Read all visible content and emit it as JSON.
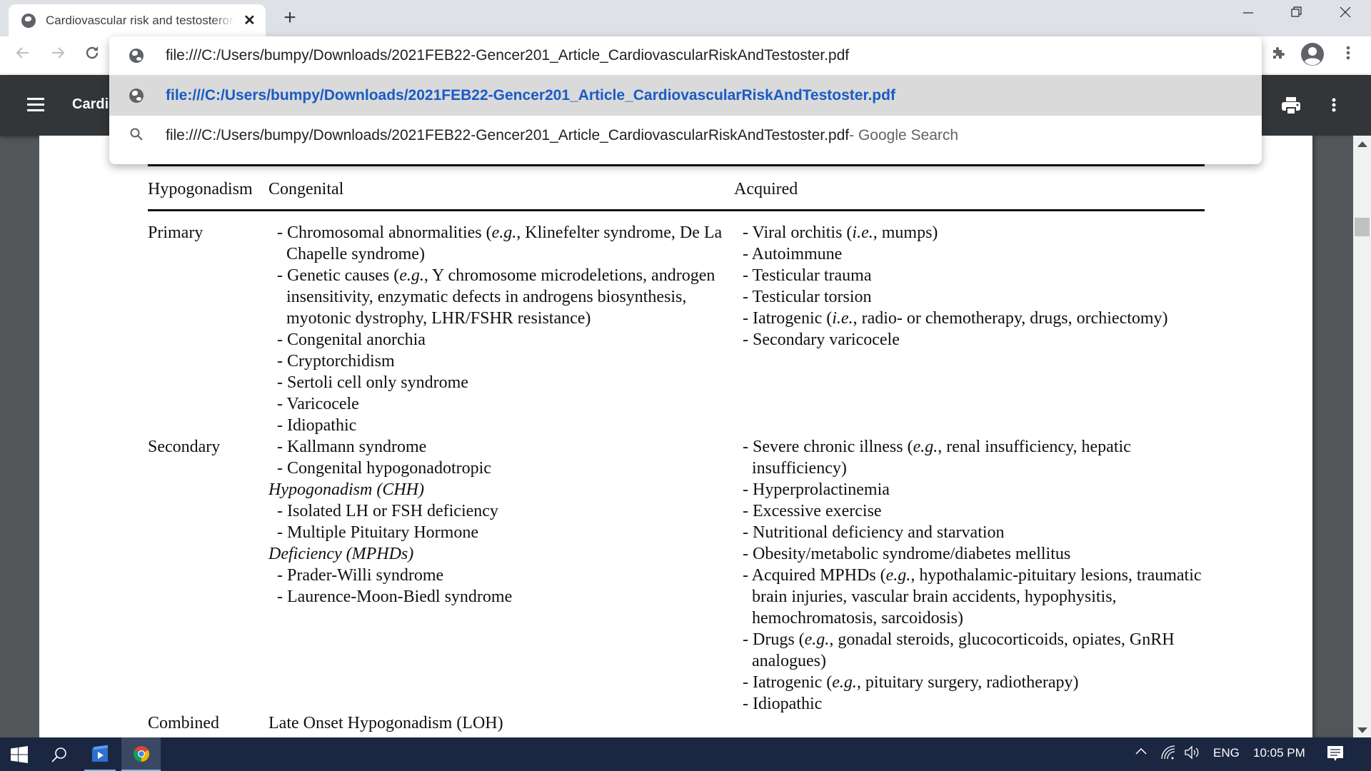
{
  "browser": {
    "tab_title": "Cardiovascular risk and testosterone",
    "new_tab_label": "+",
    "address_text": "file:///C:/Users/bumpy/Downloads/2021FEB22-Gencer201_Article_CardiovascularRiskAndTestoster.pdf",
    "suggestions": [
      {
        "icon": "globe-icon",
        "text": "file:///C:/Users/bumpy/Downloads/2021FEB22-Gencer201_Article_CardiovascularRiskAndTestoster.pdf",
        "suffix": "",
        "selected": true
      },
      {
        "icon": "search-icon",
        "text": "file:///C:/Users/bumpy/Downloads/2021FEB22-Gencer201_Article_CardiovascularRiskAndTestoster.pdf",
        "suffix": " - Google Search",
        "selected": false
      }
    ],
    "accent_color": "#1a5bc4"
  },
  "pdf_viewer": {
    "title": "Cardiovascular risk and testosterone"
  },
  "table": {
    "headers": [
      "Hypogonadism",
      "Congenital",
      "Acquired"
    ],
    "rows": [
      {
        "label": "Primary",
        "congenital": [
          {
            "pre": "- Chromosomal abnormalities (",
            "it": "e.g.",
            "post": ", Klinefelter syndrome, De La Chapelle syndrome)"
          },
          {
            "pre": "- Genetic causes (",
            "it": "e.g.",
            "post": ", Y chromosome microdeletions, androgen insensitivity, enzymatic defects in androgens biosynthesis, myotonic dystrophy, LHR/FSHR resistance)"
          },
          {
            "pre": "- Congenital anorchia"
          },
          {
            "pre": "- Cryptorchidism"
          },
          {
            "pre": "- Sertoli cell only syndrome"
          },
          {
            "pre": "- Varicocele"
          },
          {
            "pre": "- Idiopathic"
          }
        ],
        "acquired": [
          {
            "pre": "- Viral orchitis (",
            "it": "i.e.",
            "post": ", mumps)"
          },
          {
            "pre": "- Autoimmune"
          },
          {
            "pre": "- Testicular trauma"
          },
          {
            "pre": "- Testicular torsion"
          },
          {
            "pre": "- Iatrogenic (",
            "it": "i.e.",
            "post": ", radio- or chemotherapy, drugs, orchiectomy)"
          },
          {
            "pre": "- Secondary varicocele"
          }
        ]
      },
      {
        "label": "Secondary",
        "congenital": [
          {
            "pre": "- Kallmann syndrome"
          },
          {
            "pre": "- Congenital hypogonadotropic"
          },
          {
            "it_line": "Hypogonadism (CHH)"
          },
          {
            "pre": "- Isolated LH or FSH deficiency"
          },
          {
            "pre": "- Multiple Pituitary Hormone"
          },
          {
            "it_line": "Deficiency (MPHDs)"
          },
          {
            "pre": "- Prader-Willi syndrome"
          },
          {
            "pre": "- Laurence-Moon-Biedl syndrome"
          }
        ],
        "acquired": [
          {
            "pre": "- Severe chronic illness (",
            "it": "e.g.",
            "post": ", renal insufficiency, hepatic insufficiency)"
          },
          {
            "pre": "- Hyperprolactinemia"
          },
          {
            "pre": "- Excessive exercise"
          },
          {
            "pre": "- Nutritional deficiency and starvation"
          },
          {
            "pre": "- Obesity/metabolic syndrome/diabetes mellitus"
          },
          {
            "pre": "- Acquired MPHDs (",
            "it": "e.g.",
            "post": ", hypothalamic-pituitary lesions, traumatic brain injuries, vascular brain accidents, hypophysitis, hemochromatosis, sarcoidosis)"
          },
          {
            "pre": "- Drugs (",
            "it": "e.g.",
            "post": ", gonadal steroids, glucocorticoids, opiates, GnRH analogues)"
          },
          {
            "pre": "- Iatrogenic (",
            "it": "e.g.",
            "post": ", pituitary surgery, radiotherapy)"
          },
          {
            "pre": "- Idiopathic"
          }
        ]
      },
      {
        "label": "Combined",
        "congenital": [
          {
            "pre": "Late Onset Hypogonadism (LOH)"
          }
        ],
        "acquired": []
      }
    ]
  },
  "taskbar": {
    "language": "ENG",
    "time": "10:05 PM"
  }
}
